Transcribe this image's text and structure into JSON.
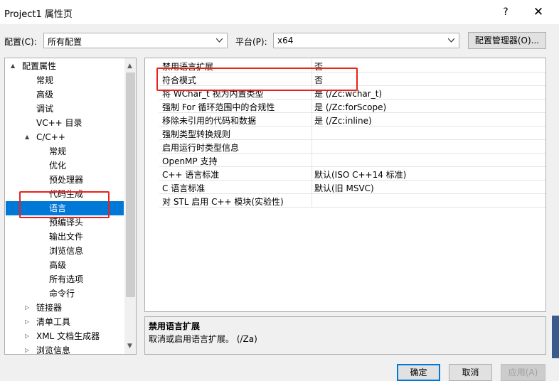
{
  "window": {
    "title": "Project1 属性页",
    "help_label": "?",
    "close_label": "✕"
  },
  "toolbar": {
    "config_label": "配置(C):",
    "config_value": "所有配置",
    "platform_label": "平台(P):",
    "platform_value": "x64",
    "manager_label": "配置管理器(O)..."
  },
  "tree": {
    "items": [
      {
        "label": "配置属性",
        "expander": "▲"
      },
      {
        "label": "常规",
        "expander": ""
      },
      {
        "label": "高级",
        "expander": ""
      },
      {
        "label": "调试",
        "expander": ""
      },
      {
        "label": "VC++ 目录",
        "expander": ""
      },
      {
        "label": "C/C++",
        "expander": "▲"
      },
      {
        "label": "常规",
        "expander": ""
      },
      {
        "label": "优化",
        "expander": ""
      },
      {
        "label": "预处理器",
        "expander": ""
      },
      {
        "label": "代码生成",
        "expander": ""
      },
      {
        "label": "语言",
        "expander": ""
      },
      {
        "label": "预编译头",
        "expander": ""
      },
      {
        "label": "输出文件",
        "expander": ""
      },
      {
        "label": "浏览信息",
        "expander": ""
      },
      {
        "label": "高级",
        "expander": ""
      },
      {
        "label": "所有选项",
        "expander": ""
      },
      {
        "label": "命令行",
        "expander": ""
      },
      {
        "label": "链接器",
        "expander": "▷"
      },
      {
        "label": "清单工具",
        "expander": "▷"
      },
      {
        "label": "XML 文档生成器",
        "expander": "▷"
      },
      {
        "label": "浏览信息",
        "expander": "▷"
      }
    ],
    "selected_label": "语言",
    "scroll_up": "▲",
    "scroll_down": "▼"
  },
  "properties": {
    "rows": [
      {
        "name": "禁用语言扩展",
        "value": "否"
      },
      {
        "name": "符合模式",
        "value": "否"
      },
      {
        "name": "将 WChar_t 视为内置类型",
        "value": "是 (/Zc:wchar_t)"
      },
      {
        "name": "强制 For 循环范围中的合规性",
        "value": "是 (/Zc:forScope)"
      },
      {
        "name": "移除未引用的代码和数据",
        "value": "是 (/Zc:inline)"
      },
      {
        "name": "强制类型转换规则",
        "value": ""
      },
      {
        "name": "启用运行时类型信息",
        "value": ""
      },
      {
        "name": "OpenMP 支持",
        "value": ""
      },
      {
        "name": "C++ 语言标准",
        "value": "默认(ISO C++14 标准)"
      },
      {
        "name": "C 语言标准",
        "value": "默认(旧 MSVC)"
      },
      {
        "name": "对 STL 启用 C++ 模块(实验性)",
        "value": ""
      }
    ]
  },
  "description": {
    "heading": "禁用语言扩展",
    "text": "取消或启用语言扩展。     (/Za)"
  },
  "buttons": {
    "ok": "确定",
    "cancel": "取消",
    "apply": "应用(A)"
  }
}
